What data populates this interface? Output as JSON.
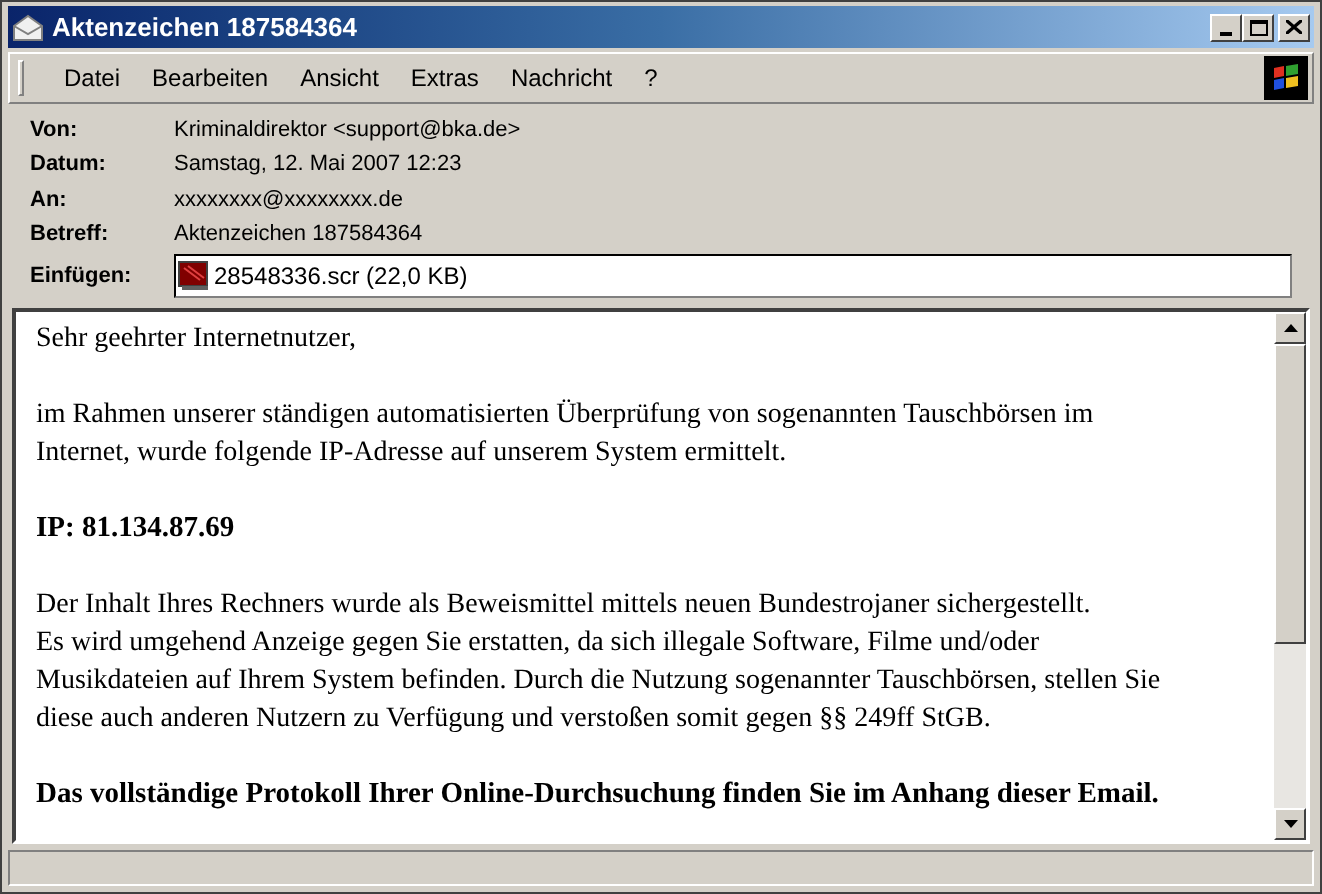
{
  "window": {
    "title": "Aktenzeichen 187584364"
  },
  "menu": [
    "Datei",
    "Bearbeiten",
    "Ansicht",
    "Extras",
    "Nachricht",
    "?"
  ],
  "headers": [
    {
      "kind": "text",
      "label": "Von:",
      "value": "Kriminaldirektor <support@bka.de>"
    },
    {
      "kind": "text",
      "label": "Datum:",
      "value": "Samstag, 12. Mai 2007 12:23"
    },
    {
      "kind": "text",
      "label": "An:",
      "value": "xxxxxxxx@xxxxxxxx.de"
    },
    {
      "kind": "text",
      "label": "Betreff:",
      "value": "Aktenzeichen 187584364"
    },
    {
      "kind": "attachment",
      "label": "Einfügen:",
      "value": "28548336.scr (22,0 KB)"
    }
  ],
  "body": [
    {
      "kind": "text",
      "lines": [
        "Sehr geehrter Internetnutzer,"
      ]
    },
    {
      "kind": "text",
      "lines": [
        "im Rahmen unserer ständigen automatisierten Überprüfung von sogenannten Tauschbörsen im",
        "Internet, wurde folgende IP-Adresse auf unserem System ermittelt."
      ]
    },
    {
      "kind": "bold",
      "lines": [
        "IP: 81.134.87.69"
      ]
    },
    {
      "kind": "text",
      "lines": [
        "Der Inhalt Ihres Rechners wurde als Beweismittel mittels neuen Bundestrojaner sichergestellt.",
        "Es wird umgehend Anzeige gegen Sie erstatten, da sich illegale Software, Filme und/oder",
        "Musikdateien auf Ihrem System befinden. Durch die Nutzung sogenannter Tauschbörsen, stellen Sie",
        "diese auch anderen Nutzern zu Verfügung und verstoßen somit gegen §§ 249ff StGB."
      ]
    },
    {
      "kind": "bold",
      "lines": [
        "Das vollständige Protokoll Ihrer Online-Durchsuchung finden Sie im Anhang dieser Email."
      ]
    }
  ]
}
